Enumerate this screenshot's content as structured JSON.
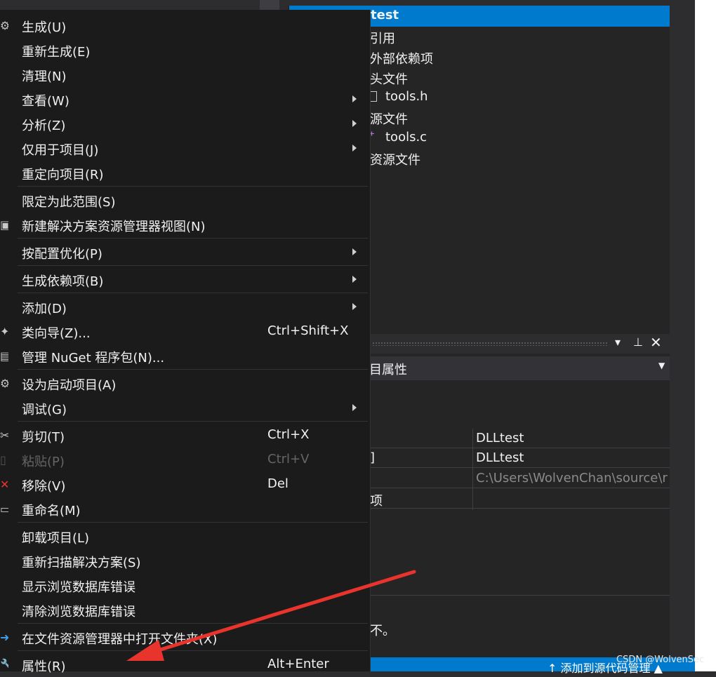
{
  "menu": {
    "items": [
      {
        "label": "生成(U)",
        "shortcut": "",
        "submenu": false,
        "icon": "build-icon"
      },
      {
        "label": "重新生成(E)",
        "shortcut": "",
        "submenu": false,
        "icon": ""
      },
      {
        "label": "清理(N)",
        "shortcut": "",
        "submenu": false,
        "icon": ""
      },
      {
        "label": "查看(W)",
        "shortcut": "",
        "submenu": true,
        "icon": ""
      },
      {
        "label": "分析(Z)",
        "shortcut": "",
        "submenu": true,
        "icon": ""
      },
      {
        "label": "仅用于项目(J)",
        "shortcut": "",
        "submenu": true,
        "icon": ""
      },
      {
        "label": "重定向项目(R)",
        "shortcut": "",
        "submenu": false,
        "icon": ""
      },
      {
        "label": "限定为此范围(S)",
        "shortcut": "",
        "submenu": false,
        "icon": ""
      },
      {
        "label": "新建解决方案资源管理器视图(N)",
        "shortcut": "",
        "submenu": false,
        "icon": "new-view-icon"
      },
      {
        "label": "按配置优化(P)",
        "shortcut": "",
        "submenu": true,
        "icon": ""
      },
      {
        "label": "生成依赖项(B)",
        "shortcut": "",
        "submenu": true,
        "icon": ""
      },
      {
        "label": "添加(D)",
        "shortcut": "",
        "submenu": true,
        "icon": ""
      },
      {
        "label": "类向导(Z)...",
        "shortcut": "Ctrl+Shift+X",
        "submenu": false,
        "icon": "class-wizard-icon"
      },
      {
        "label": "管理 NuGet 程序包(N)...",
        "shortcut": "",
        "submenu": false,
        "icon": "nuget-icon"
      },
      {
        "label": "设为启动项目(A)",
        "shortcut": "",
        "submenu": false,
        "icon": "gear-icon"
      },
      {
        "label": "调试(G)",
        "shortcut": "",
        "submenu": true,
        "icon": ""
      },
      {
        "label": "剪切(T)",
        "shortcut": "Ctrl+X",
        "submenu": false,
        "icon": "scissors-icon"
      },
      {
        "label": "粘贴(P)",
        "shortcut": "Ctrl+V",
        "submenu": false,
        "icon": "paste-icon",
        "disabled": true
      },
      {
        "label": "移除(V)",
        "shortcut": "Del",
        "submenu": false,
        "icon": "remove-icon"
      },
      {
        "label": "重命名(M)",
        "shortcut": "",
        "submenu": false,
        "icon": "rename-icon"
      },
      {
        "label": "卸载项目(L)",
        "shortcut": "",
        "submenu": false,
        "icon": ""
      },
      {
        "label": "重新扫描解决方案(S)",
        "shortcut": "",
        "submenu": false,
        "icon": ""
      },
      {
        "label": "显示浏览数据库错误",
        "shortcut": "",
        "submenu": false,
        "icon": ""
      },
      {
        "label": "清除浏览数据库错误",
        "shortcut": "",
        "submenu": false,
        "icon": ""
      },
      {
        "label": "在文件资源管理器中打开文件夹(X)",
        "shortcut": "",
        "submenu": false,
        "icon": "open-folder-arrow-icon"
      },
      {
        "label": "属性(R)",
        "shortcut": "Alt+Enter",
        "submenu": false,
        "icon": "wrench-icon"
      }
    ]
  },
  "solution_tree": {
    "project_label": "test",
    "items": [
      {
        "label": "引用"
      },
      {
        "label": "外部依赖项"
      },
      {
        "label": "头文件"
      },
      {
        "label": "tools.h"
      },
      {
        "label": "源文件"
      },
      {
        "label": "tools.c"
      },
      {
        "label": "资源文件"
      }
    ]
  },
  "properties": {
    "header_buttons": [
      "▾",
      "📌",
      "✕"
    ],
    "combo_label": "目属性",
    "rows": [
      {
        "name": "",
        "value": "DLLtest"
      },
      {
        "name": "]",
        "value": "DLLtest"
      },
      {
        "name": "",
        "value": "C:\\Users\\WolvenChan\\source\\r"
      },
      {
        "name": "项",
        "value": ""
      }
    ],
    "partial_desc": "不。"
  },
  "status_bar": {
    "text": "↑ 添加到源代码管理 ▲"
  },
  "watermark": "CSDN @WolvenSec",
  "annotation": {
    "arrow_color": "#e8342c"
  }
}
